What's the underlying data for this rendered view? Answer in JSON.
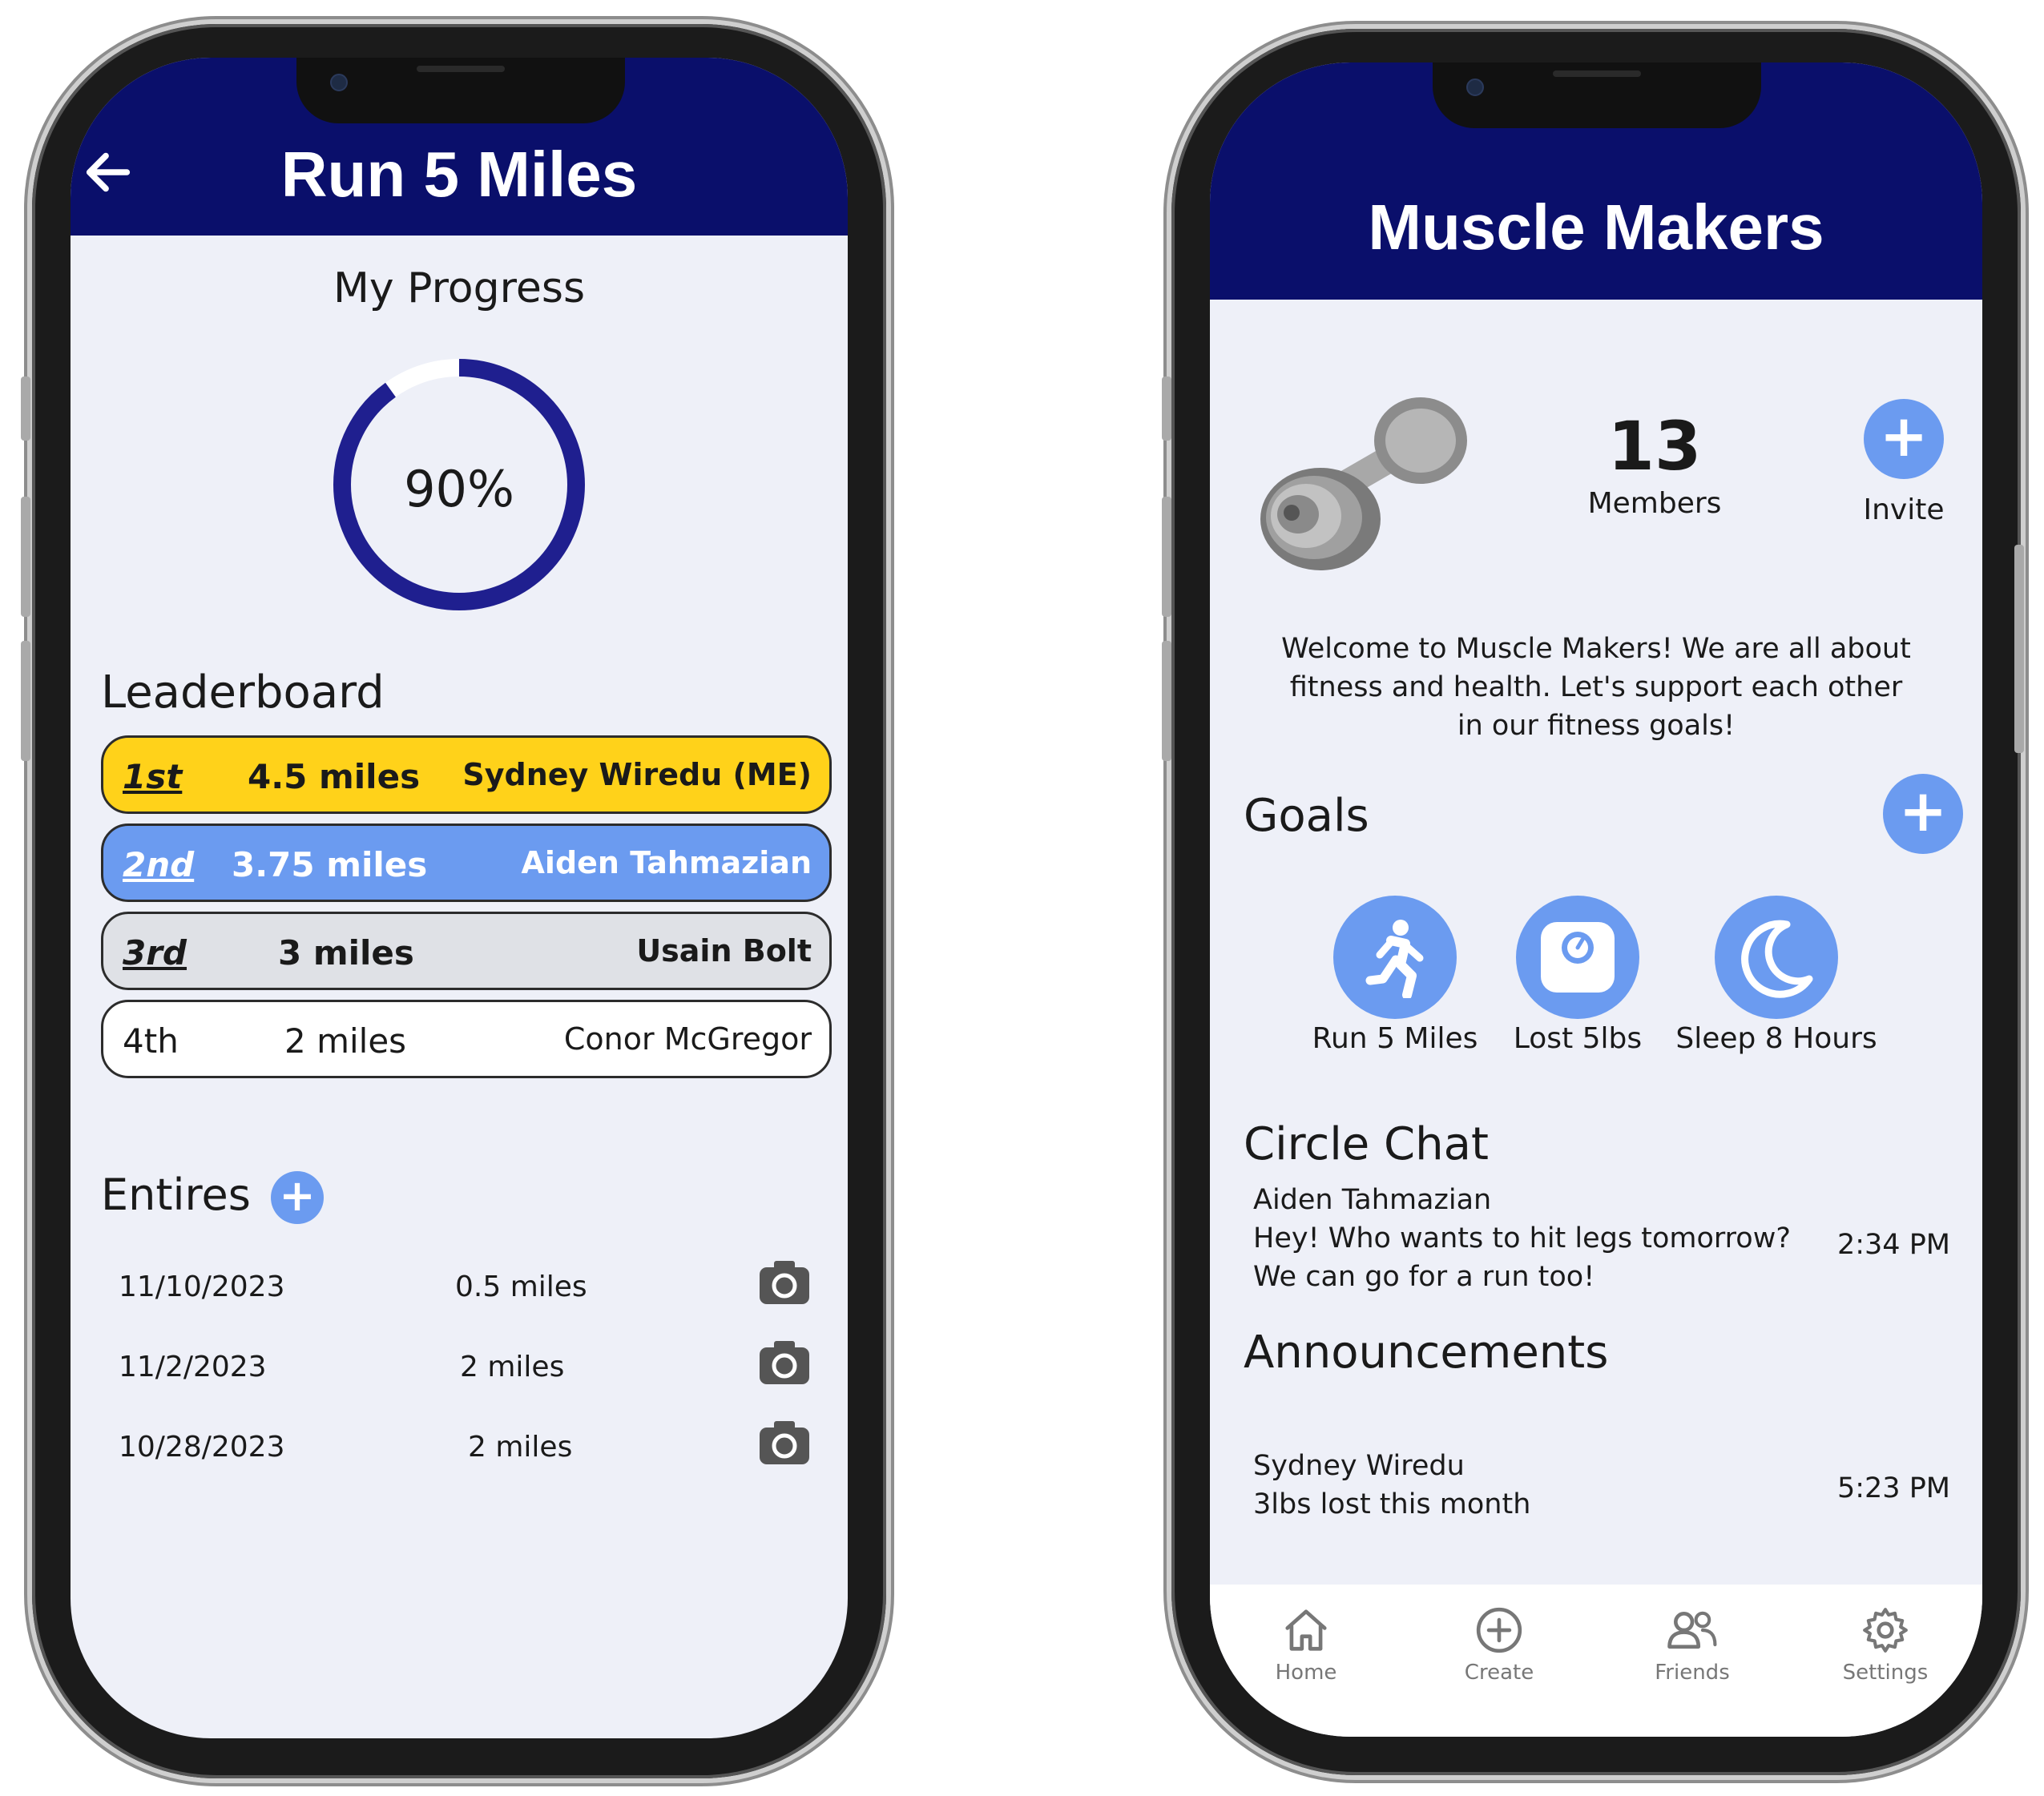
{
  "left_screen": {
    "title": "Run 5 Miles",
    "back_icon": "arrow-left-icon",
    "progress": {
      "heading": "My Progress",
      "value_label": "90%",
      "fraction": 0.9,
      "ring_color": "#1f1f8f"
    },
    "leaderboard": {
      "heading": "Leaderboard",
      "rows": [
        {
          "rank": "1st",
          "distance": "4.5 miles",
          "name": "Sydney Wiredu (ME)",
          "color": "#ffd21a"
        },
        {
          "rank": "2nd",
          "distance": "3.75 miles",
          "name": "Aiden Tahmazian",
          "color": "#6b9bf0"
        },
        {
          "rank": "3rd",
          "distance": "3 miles",
          "name": "Usain Bolt",
          "color": "#dfe1e6"
        },
        {
          "rank": "4th",
          "distance": "2 miles",
          "name": "Conor McGregor",
          "color": "#ffffff"
        }
      ]
    },
    "entries": {
      "heading": "Entires",
      "items": [
        {
          "date": "11/10/2023",
          "distance": "0.5 miles",
          "icon": "camera-icon"
        },
        {
          "date": "11/2/2023",
          "distance": "2 miles",
          "icon": "camera-icon"
        },
        {
          "date": "10/28/2023",
          "distance": "2 miles",
          "icon": "camera-icon"
        }
      ]
    }
  },
  "right_screen": {
    "title": "Muscle Makers",
    "group_icon": "dumbbell-icon",
    "members_count": "13",
    "members_label": "Members",
    "invite_label": "Invite",
    "welcome_lines": [
      "Welcome to Muscle Makers! We are all about",
      "fitness and health. Let's support each other",
      "in our fitness goals!"
    ],
    "goals_heading": "Goals",
    "goals": [
      {
        "label": "Run 5 Miles",
        "icon": "runner-icon"
      },
      {
        "label": "Lost 5lbs",
        "icon": "scale-icon"
      },
      {
        "label": "Sleep 8 Hours",
        "icon": "moon-icon"
      }
    ],
    "chat": {
      "heading": "Circle Chat",
      "author": "Aiden Tahmazian",
      "line1": "Hey! Who wants to hit legs tomorrow?",
      "line2": "We can go for a run too!",
      "time": "2:34 PM"
    },
    "announcements": {
      "heading": "Announcements",
      "author": "Sydney Wiredu",
      "text": "3lbs lost this month",
      "time": "5:23 PM"
    },
    "nav": [
      {
        "label": "Home",
        "icon": "home-icon"
      },
      {
        "label": "Create",
        "icon": "plus-circle-icon"
      },
      {
        "label": "Friends",
        "icon": "friends-icon"
      },
      {
        "label": "Settings",
        "icon": "gear-icon"
      }
    ]
  },
  "colors": {
    "header_navy": "#0a0f6b",
    "accent_blue": "#6b9bf0",
    "screen_bg": "#eef0f8"
  }
}
